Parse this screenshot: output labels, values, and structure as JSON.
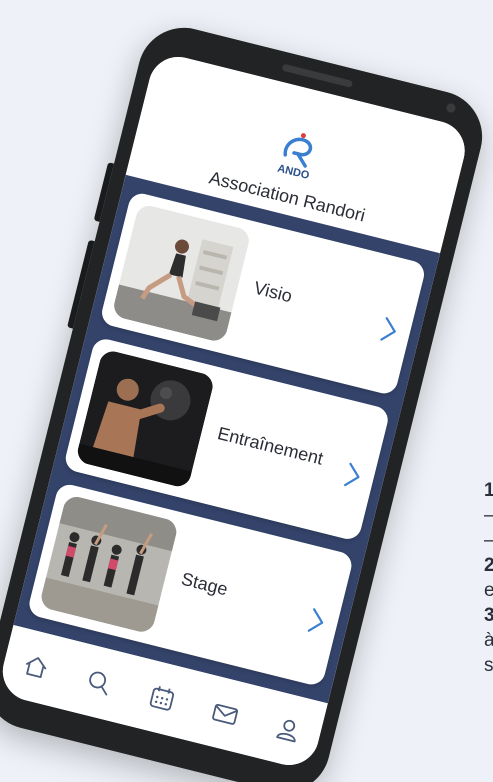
{
  "app": {
    "title": "Association Randori",
    "logo_text": "ANDO"
  },
  "cards": [
    {
      "label": "Visio",
      "image": "fitness-lunge-photo"
    },
    {
      "label": "Entraînement",
      "image": "boxer-medicine-ball-photo"
    },
    {
      "label": "Stage",
      "image": "group-dance-class-photo"
    }
  ],
  "bottom_nav": [
    {
      "name": "home-icon"
    },
    {
      "name": "search-icon"
    },
    {
      "name": "calendar-icon"
    },
    {
      "name": "mail-icon"
    },
    {
      "name": "user-icon"
    }
  ],
  "side_text": {
    "line1": "1",
    "line2": "–",
    "line3": "–",
    "line4": "2",
    "line5": "e",
    "line6": "3",
    "line7": "à",
    "line8": "s"
  },
  "colors": {
    "page_background": "#eef2f8",
    "phone_body": "#222325",
    "list_background": "#34436a",
    "accent": "#3b7fd1"
  }
}
